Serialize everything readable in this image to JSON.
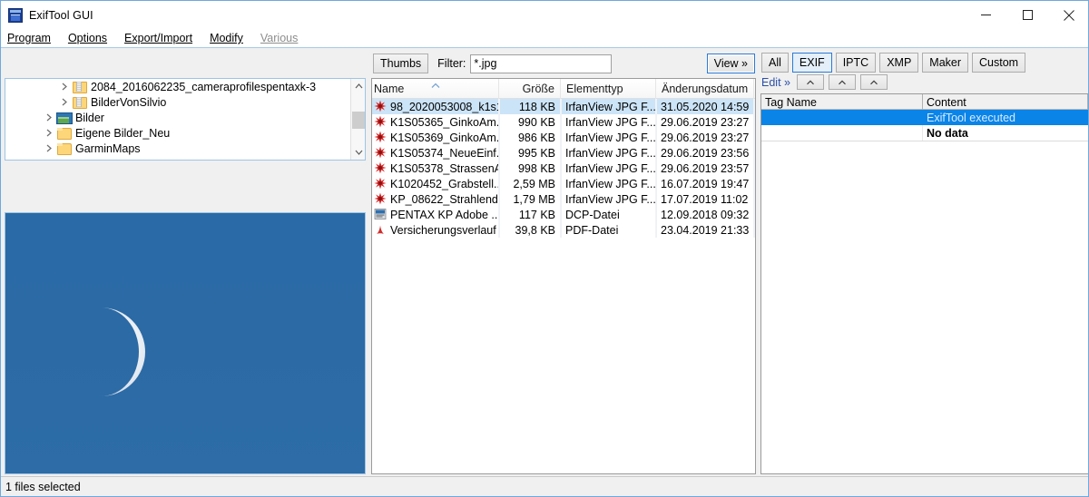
{
  "window": {
    "title": "ExifTool GUI",
    "icon": "app-camera-icon",
    "minimize_label": "Minimize",
    "maximize_label": "Maximize",
    "close_label": "Close"
  },
  "menu": {
    "items": [
      {
        "label": "Program",
        "accel": "P",
        "disabled": false
      },
      {
        "label": "Options",
        "accel": "O",
        "disabled": false
      },
      {
        "label": "Export/Import",
        "accel": "E",
        "disabled": false
      },
      {
        "label": "Modify",
        "accel": "M",
        "disabled": false
      },
      {
        "label": "Various",
        "accel": "V",
        "disabled": true
      }
    ]
  },
  "tree": {
    "items": [
      {
        "label": "2084_2016062235_cameraprofilespentaxk-3",
        "icon": "zipped-folder-icon",
        "indent": 2,
        "expandable": true
      },
      {
        "label": "BilderVonSilvio",
        "icon": "zipped-folder-icon",
        "indent": 2,
        "expandable": true
      },
      {
        "label": "Bilder",
        "icon": "pictures-folder-icon",
        "indent": 1,
        "expandable": true
      },
      {
        "label": "Eigene Bilder_Neu",
        "icon": "folder-icon",
        "indent": 1,
        "expandable": true
      },
      {
        "label": "GarminMaps",
        "icon": "folder-icon",
        "indent": 1,
        "expandable": true
      }
    ]
  },
  "preview": {
    "alt": "Half moon in blue sky",
    "sky_color": "#2a69a4",
    "moon_color": "#e9eef5"
  },
  "filelist": {
    "toolbar": {
      "thumbs_label": "Thumbs",
      "filter_label": "Filter:",
      "filter_value": "*.jpg",
      "view_label": "View »"
    },
    "columns": [
      {
        "key": "name",
        "label": "Name",
        "sorted": "asc"
      },
      {
        "key": "size",
        "label": "Größe",
        "align": "right"
      },
      {
        "key": "type",
        "label": "Elementtyp"
      },
      {
        "key": "date",
        "label": "Änderungsdatum"
      }
    ],
    "rows": [
      {
        "name": "98_2020053008_k1s1...",
        "size": "118 KB",
        "type": "IrfanView JPG F...",
        "date": "31.05.2020 14:59",
        "icon": "irfanview-icon",
        "selected": true
      },
      {
        "name": "K1S05365_GinkoAm...",
        "size": "990 KB",
        "type": "IrfanView JPG F...",
        "date": "29.06.2019 23:27",
        "icon": "irfanview-icon",
        "selected": false
      },
      {
        "name": "K1S05369_GinkoAm...",
        "size": "986 KB",
        "type": "IrfanView JPG F...",
        "date": "29.06.2019 23:27",
        "icon": "irfanview-icon",
        "selected": false
      },
      {
        "name": "K1S05374_NeueEinf...",
        "size": "995 KB",
        "type": "IrfanView JPG F...",
        "date": "29.06.2019 23:56",
        "icon": "irfanview-icon",
        "selected": false
      },
      {
        "name": "K1S05378_StrassenA...",
        "size": "998 KB",
        "type": "IrfanView JPG F...",
        "date": "29.06.2019 23:57",
        "icon": "irfanview-icon",
        "selected": false
      },
      {
        "name": "K1020452_Grabstell...",
        "size": "2,59 MB",
        "type": "IrfanView JPG F...",
        "date": "16.07.2019 19:47",
        "icon": "irfanview-icon",
        "selected": false
      },
      {
        "name": "KP_08622_Strahlend...",
        "size": "1,79 MB",
        "type": "IrfanView JPG F...",
        "date": "17.07.2019 11:02",
        "icon": "irfanview-icon",
        "selected": false
      },
      {
        "name": "PENTAX KP Adobe ...",
        "size": "117 KB",
        "type": "DCP-Datei",
        "date": "12.09.2018 09:32",
        "icon": "dcp-file-icon",
        "selected": false
      },
      {
        "name": "Versicherungsverlauf",
        "size": "39,8 KB",
        "type": "PDF-Datei",
        "date": "23.04.2019 21:33",
        "icon": "pdf-file-icon",
        "selected": false
      }
    ]
  },
  "metadata": {
    "tabs": [
      {
        "label": "All",
        "active": false
      },
      {
        "label": "EXIF",
        "active": true
      },
      {
        "label": "IPTC",
        "active": false
      },
      {
        "label": "XMP",
        "active": false
      },
      {
        "label": "Maker",
        "active": false
      },
      {
        "label": "Custom",
        "active": false
      }
    ],
    "edit_label": "Edit »",
    "caret_buttons": [
      {
        "name": "caret-button-1",
        "glyph": "^"
      },
      {
        "name": "caret-button-2",
        "glyph": "^"
      },
      {
        "name": "caret-button-3",
        "glyph": "^"
      }
    ],
    "columns": {
      "tag_name": "Tag Name",
      "content": "Content"
    },
    "rows": [
      {
        "tag": "",
        "content": "ExifTool executed",
        "selected": true,
        "bold": false
      },
      {
        "tag": "",
        "content": "No data",
        "selected": false,
        "bold": true
      }
    ]
  },
  "statusbar": {
    "text": "1 files selected"
  },
  "colors": {
    "accent_blue": "#0b84e8",
    "selection_light": "#cce4f7",
    "window_border": "#6fa8dc",
    "panel_bg": "#f0f0f0",
    "link": "#2b4fa8"
  }
}
